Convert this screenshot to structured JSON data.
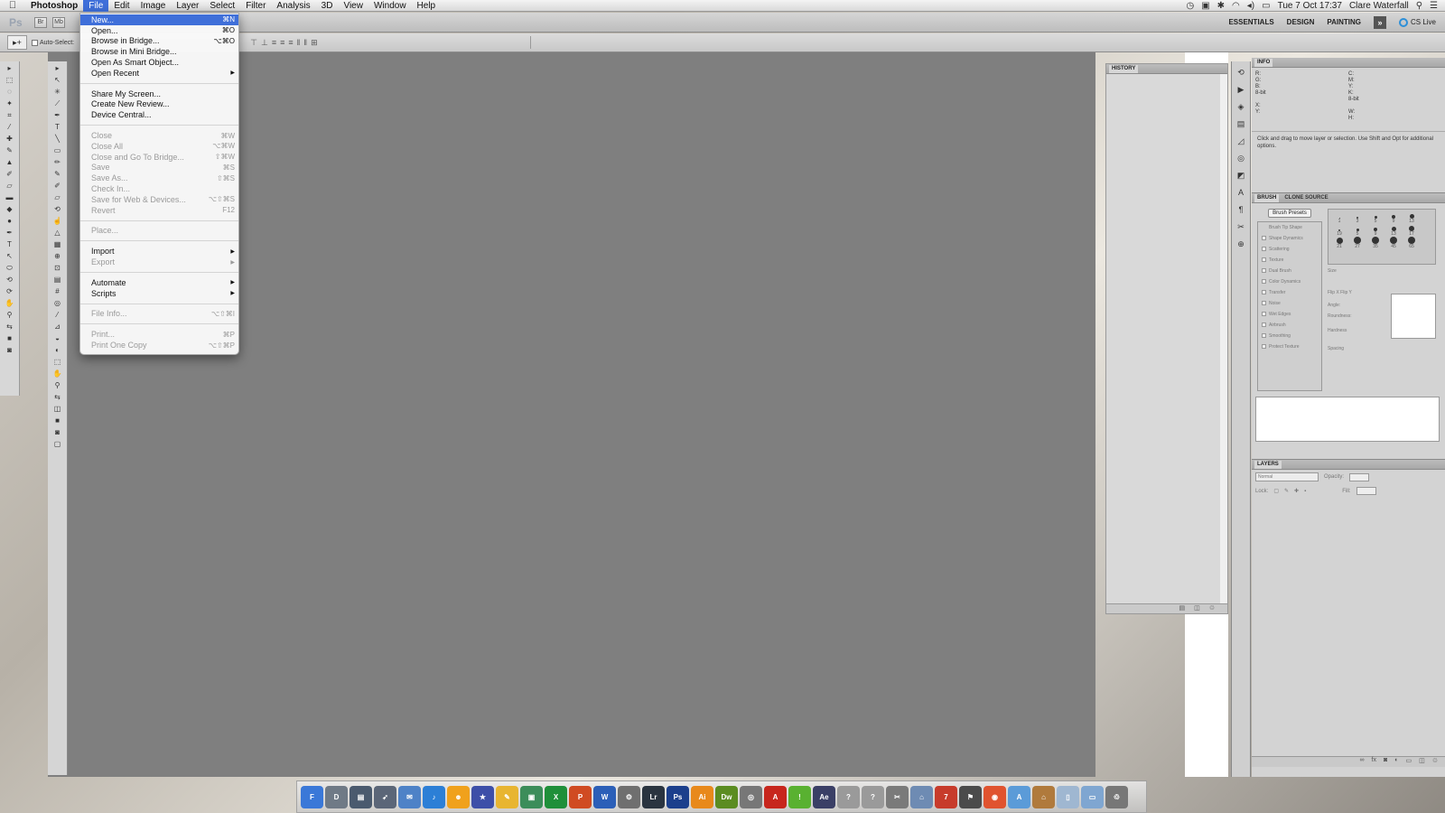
{
  "menubar": {
    "app": "Photoshop",
    "menus": [
      "File",
      "Edit",
      "Image",
      "Layer",
      "Select",
      "Filter",
      "Analysis",
      "3D",
      "View",
      "Window",
      "Help"
    ],
    "clock": "Tue 7 Oct  17:37",
    "user": "Clare Waterfall"
  },
  "appbar": {
    "logo": "Ps",
    "mini_buttons": [
      "Br",
      "Mb"
    ],
    "workspaces": [
      "ESSENTIALS",
      "DESIGN",
      "PAINTING"
    ],
    "more": "»",
    "cslive": "CS Live"
  },
  "options": {
    "autoselect_label": "Auto-Select:"
  },
  "file_menu": {
    "items": [
      {
        "label": "New...",
        "shortcut": "⌘N",
        "highlighted": true
      },
      {
        "label": "Open...",
        "shortcut": "⌘O"
      },
      {
        "label": "Browse in Bridge...",
        "shortcut": "⌥⌘O"
      },
      {
        "label": "Browse in Mini Bridge...",
        "shortcut": ""
      },
      {
        "label": "Open As Smart Object...",
        "shortcut": ""
      },
      {
        "label": "Open Recent",
        "shortcut": "",
        "submenu": true
      },
      {
        "divider": true
      },
      {
        "label": "Share My Screen...",
        "shortcut": ""
      },
      {
        "label": "Create New Review...",
        "shortcut": ""
      },
      {
        "label": "Device Central...",
        "shortcut": ""
      },
      {
        "divider": true
      },
      {
        "label": "Close",
        "shortcut": "⌘W",
        "disabled": true
      },
      {
        "label": "Close All",
        "shortcut": "⌥⌘W",
        "disabled": true
      },
      {
        "label": "Close and Go To Bridge...",
        "shortcut": "⇧⌘W",
        "disabled": true
      },
      {
        "label": "Save",
        "shortcut": "⌘S",
        "disabled": true
      },
      {
        "label": "Save As...",
        "shortcut": "⇧⌘S",
        "disabled": true
      },
      {
        "label": "Check In...",
        "shortcut": "",
        "disabled": true
      },
      {
        "label": "Save for Web & Devices...",
        "shortcut": "⌥⇧⌘S",
        "disabled": true
      },
      {
        "label": "Revert",
        "shortcut": "F12",
        "disabled": true
      },
      {
        "divider": true
      },
      {
        "label": "Place...",
        "shortcut": "",
        "disabled": true
      },
      {
        "divider": true
      },
      {
        "label": "Import",
        "shortcut": "",
        "submenu": true
      },
      {
        "label": "Export",
        "shortcut": "",
        "submenu": true,
        "disabled": true
      },
      {
        "divider": true
      },
      {
        "label": "Automate",
        "shortcut": "",
        "submenu": true
      },
      {
        "label": "Scripts",
        "shortcut": "",
        "submenu": true
      },
      {
        "divider": true
      },
      {
        "label": "File Info...",
        "shortcut": "⌥⇧⌘I",
        "disabled": true
      },
      {
        "divider": true
      },
      {
        "label": "Print...",
        "shortcut": "⌘P",
        "disabled": true
      },
      {
        "label": "Print One Copy",
        "shortcut": "⌥⇧⌘P",
        "disabled": true
      }
    ]
  },
  "history_panel": {
    "tab": "HISTORY"
  },
  "info_panel": {
    "tab": "INFO",
    "rgb_labels": [
      "R:",
      "G:",
      "B:"
    ],
    "cmyk_labels": [
      "C:",
      "M:",
      "Y:",
      "K:"
    ],
    "bit_left": "8-bit",
    "bit_right": "8-bit",
    "xy_labels": [
      "X:",
      "Y:"
    ],
    "wh_labels": [
      "W:",
      "H:"
    ],
    "note": "Click and drag to move layer or selection.  Use Shift and Opt for additional options."
  },
  "brush_panel": {
    "tabs": [
      "BRUSH",
      "CLONE SOURCE"
    ],
    "presets_button": "Brush Presets",
    "options": [
      "Brush Tip Shape",
      "Shape Dynamics",
      "Scattering",
      "Texture",
      "Dual Brush",
      "Color Dynamics",
      "Transfer",
      "Noise",
      "Wet Edges",
      "Airbrush",
      "Smoothing",
      "Protect Texture"
    ],
    "sizes": [
      "1",
      "3",
      "5",
      "9",
      "13",
      "19",
      "5",
      "9",
      "13",
      "17",
      "21",
      "27",
      "35",
      "45",
      "65"
    ],
    "size_label": "Size",
    "flip_x": "Flip X",
    "flip_y": "Flip Y",
    "angle": "Angle:",
    "roundness": "Roundness:",
    "hardness": "Hardness",
    "spacing": "Spacing"
  },
  "layers_panel": {
    "tab": "LAYERS",
    "blend_mode": "Normal",
    "opacity_label": "Opacity:",
    "lock_label": "Lock:",
    "fill_label": "Fill:"
  },
  "dock": {
    "apps": [
      {
        "label": "F",
        "color": "#3a78d8"
      },
      {
        "label": "D",
        "color": "#6f7a86"
      },
      {
        "label": "▤",
        "color": "#4a5a6e"
      },
      {
        "label": "➶",
        "color": "#5b6678"
      },
      {
        "label": "✉",
        "color": "#4e82c7"
      },
      {
        "label": "♪",
        "color": "#2c7fd6"
      },
      {
        "label": "☻",
        "color": "#f0a11c"
      },
      {
        "label": "★",
        "color": "#3d4fa8"
      },
      {
        "label": "✎",
        "color": "#e8b531"
      },
      {
        "label": "▣",
        "color": "#3c8d5a"
      },
      {
        "label": "X",
        "color": "#1f8f3a"
      },
      {
        "label": "P",
        "color": "#d04b22"
      },
      {
        "label": "W",
        "color": "#2b5fb8"
      },
      {
        "label": "⚙",
        "color": "#6f6f6f"
      },
      {
        "label": "Lr",
        "color": "#2a3440"
      },
      {
        "label": "Ps",
        "color": "#1b3f8c"
      },
      {
        "label": "Ai",
        "color": "#e8891b"
      },
      {
        "label": "Dw",
        "color": "#5b8c21"
      },
      {
        "label": "◎",
        "color": "#777777"
      },
      {
        "label": "A",
        "color": "#c7261d"
      },
      {
        "label": "!",
        "color": "#59b131"
      },
      {
        "label": "Ae",
        "color": "#3a3f66"
      },
      {
        "label": "?",
        "color": "#9a9a9a"
      },
      {
        "label": "?",
        "color": "#9a9a9a"
      },
      {
        "label": "✂",
        "color": "#7a7a7a"
      },
      {
        "label": "⌂",
        "color": "#6e8bb3"
      },
      {
        "label": "7",
        "color": "#c73b2b"
      },
      {
        "label": "⚑",
        "color": "#4b4b4b"
      },
      {
        "label": "◉",
        "color": "#e0532f"
      },
      {
        "label": "A",
        "color": "#5b9bd8"
      },
      {
        "label": "⌂",
        "color": "#b07a3c"
      },
      {
        "label": "▯",
        "color": "#9fb7d1"
      },
      {
        "label": "▭",
        "color": "#7fa6d1"
      },
      {
        "label": "♲",
        "color": "#777777"
      }
    ]
  }
}
